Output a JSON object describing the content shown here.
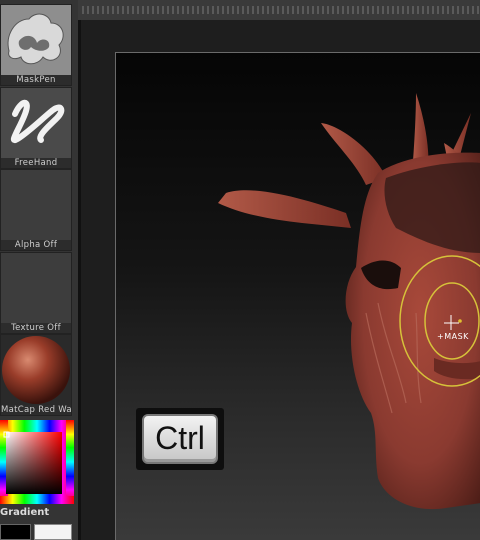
{
  "tools": [
    {
      "label": "MaskPen",
      "icon": "maskpen-brush-icon"
    },
    {
      "label": "FreeHand",
      "icon": "freehand-stroke-icon"
    },
    {
      "label": "Alpha Off",
      "icon": "alpha-slot-icon"
    },
    {
      "label": "Texture Off",
      "icon": "texture-slot-icon"
    },
    {
      "label": "MatCap Red Wax",
      "icon": "matcap-sphere-icon"
    }
  ],
  "color": {
    "gradient_label": "Gradient",
    "main_color": "#000000",
    "secondary_color": "#f4f4f4"
  },
  "canvas": {
    "shortcut_key": "Ctrl",
    "cursor_label": "+MASK",
    "model_color": "#8a3a30",
    "mask_color": "#2a1a18",
    "brush_ring_color": "#d6c23a"
  }
}
